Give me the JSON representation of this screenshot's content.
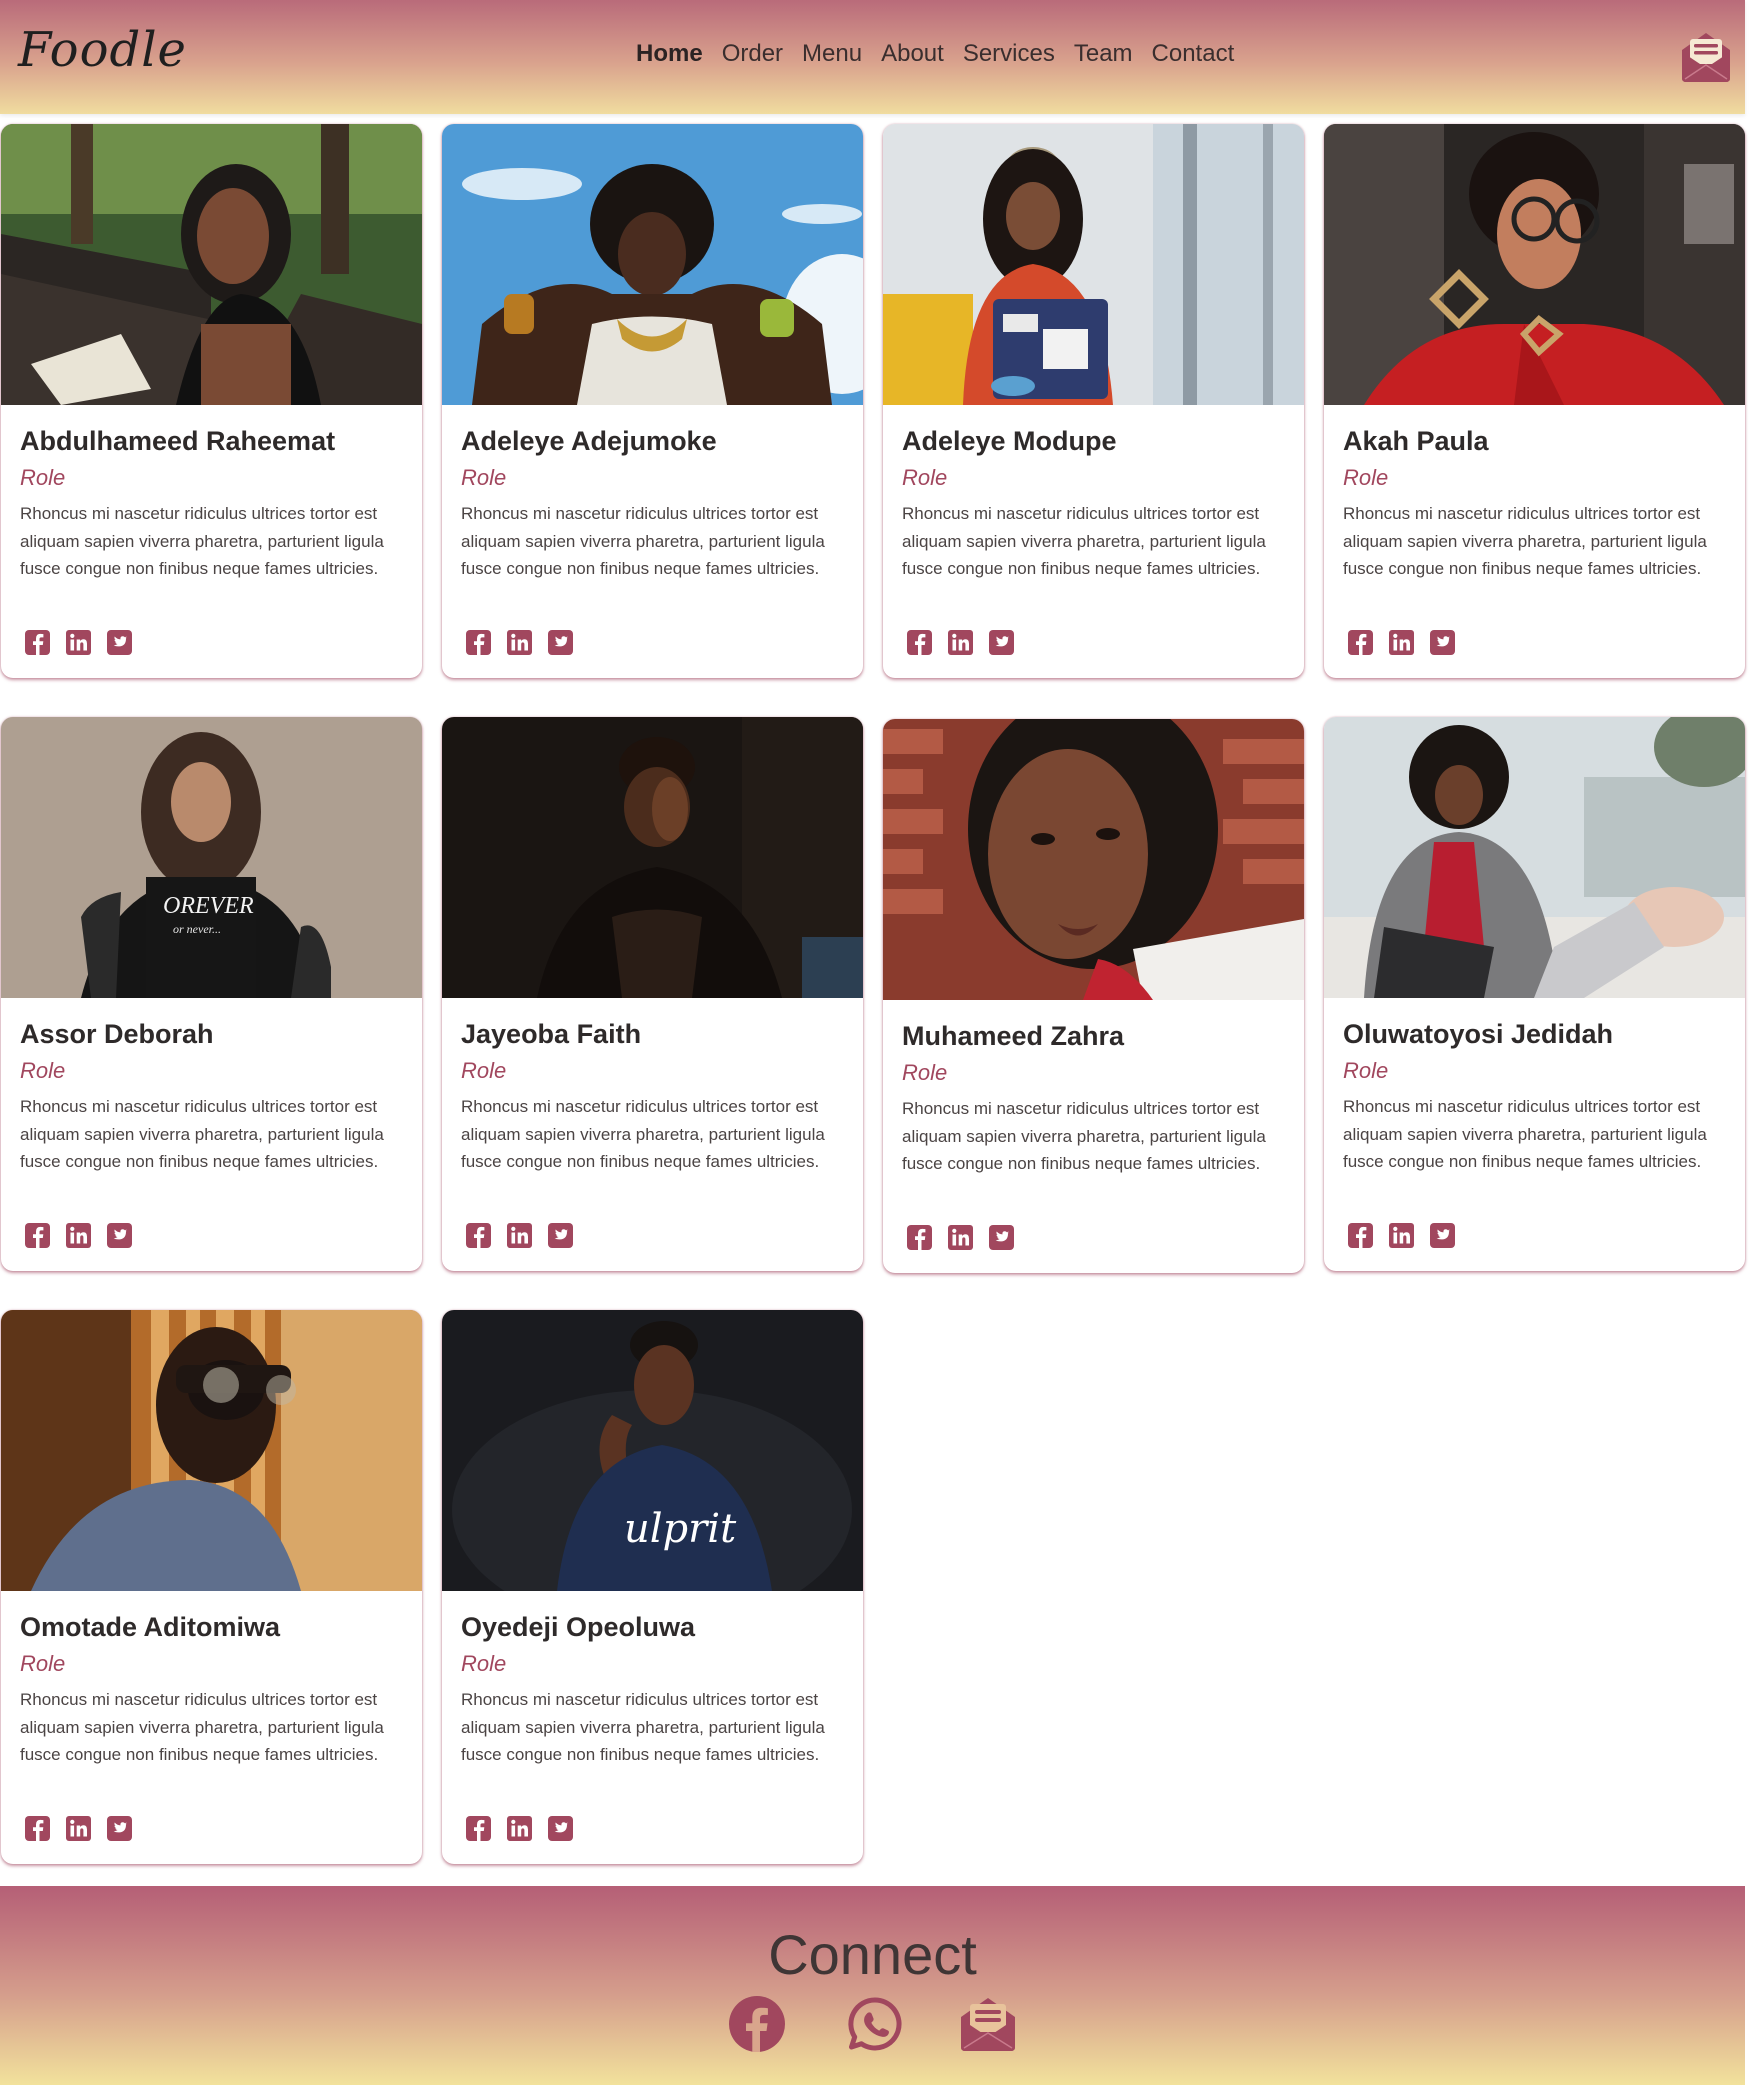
{
  "brand": {
    "logo": "Foodle"
  },
  "nav": {
    "items": [
      "Home",
      "Order",
      "Menu",
      "About",
      "Services",
      "Team",
      "Contact"
    ],
    "active": "Home"
  },
  "header": {
    "icon": "envelope-open-text-icon"
  },
  "team": {
    "members": [
      {
        "name": "Abdulhameed Raheemat",
        "role": "Role",
        "bio": "Rhoncus mi nascetur ridiculus ultrices tortor est aliquam sapien viverra pharetra, parturient ligula fusce congue non finibus neque fames ultricies."
      },
      {
        "name": "Adeleye Adejumoke",
        "role": "Role",
        "bio": "Rhoncus mi nascetur ridiculus ultrices tortor est aliquam sapien viverra pharetra, parturient ligula fusce congue non finibus neque fames ultricies."
      },
      {
        "name": "Adeleye Modupe",
        "role": "Role",
        "bio": "Rhoncus mi nascetur ridiculus ultrices tortor est aliquam sapien viverra pharetra, parturient ligula fusce congue non finibus neque fames ultricies."
      },
      {
        "name": "Akah Paula",
        "role": "Role",
        "bio": "Rhoncus mi nascetur ridiculus ultrices tortor est aliquam sapien viverra pharetra, parturient ligula fusce congue non finibus neque fames ultricies."
      },
      {
        "name": "Assor Deborah",
        "role": "Role",
        "bio": "Rhoncus mi nascetur ridiculus ultrices tortor est aliquam sapien viverra pharetra, parturient ligula fusce congue non finibus neque fames ultricies."
      },
      {
        "name": "Jayeoba Faith",
        "role": "Role",
        "bio": "Rhoncus mi nascetur ridiculus ultrices tortor est aliquam sapien viverra pharetra, parturient ligula fusce congue non finibus neque fames ultricies."
      },
      {
        "name": "Muhameed Zahra",
        "role": "Role",
        "bio": "Rhoncus mi nascetur ridiculus ultrices tortor est aliquam sapien viverra pharetra, parturient ligula fusce congue non finibus neque fames ultricies."
      },
      {
        "name": "Oluwatoyosi Jedidah",
        "role": "Role",
        "bio": "Rhoncus mi nascetur ridiculus ultrices tortor est aliquam sapien viverra pharetra, parturient ligula fusce congue non finibus neque fames ultricies."
      },
      {
        "name": "Omotade Aditomiwa",
        "role": "Role",
        "bio": "Rhoncus mi nascetur ridiculus ultrices tortor est aliquam sapien viverra pharetra, parturient ligula fusce congue non finibus neque fames ultricies."
      },
      {
        "name": "Oyedeji Opeoluwa",
        "role": "Role",
        "bio": "Rhoncus mi nascetur ridiculus ultrices tortor est aliquam sapien viverra pharetra, parturient ligula fusce congue non finibus neque fames ultricies."
      }
    ],
    "social_icons": [
      "facebook-square-icon",
      "linkedin-icon",
      "twitter-square-icon"
    ]
  },
  "footer": {
    "title": "Connect",
    "icons": [
      "facebook-icon",
      "whatsapp-icon",
      "envelope-open-text-icon"
    ]
  },
  "colors": {
    "accent": "#a1475e",
    "gradient_top": "#b96b7a",
    "gradient_bottom": "#f0dc9f"
  }
}
